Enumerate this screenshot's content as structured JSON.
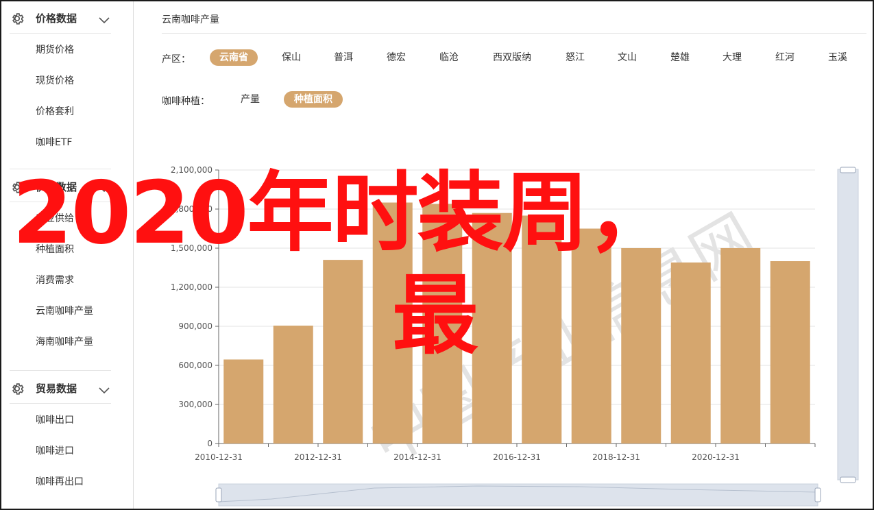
{
  "sidebar": {
    "groups": [
      {
        "title": "价格数据",
        "items": [
          "期货价格",
          "现货价格",
          "价格套利",
          "咖啡ETF"
        ]
      },
      {
        "title": "供需数据",
        "items": [
          "产业供给",
          "种植面积",
          "消费需求",
          "云南咖啡产量",
          "海南咖啡产量"
        ]
      },
      {
        "title": "贸易数据",
        "items": [
          "咖啡出口",
          "咖啡进口",
          "咖啡再出口"
        ]
      }
    ]
  },
  "main": {
    "title": "云南咖啡产量",
    "region_label": "产区：",
    "regions": [
      {
        "label": "云南省",
        "active": true
      },
      {
        "label": "保山",
        "active": false
      },
      {
        "label": "普洱",
        "active": false
      },
      {
        "label": "德宏",
        "active": false
      },
      {
        "label": "临沧",
        "active": false
      },
      {
        "label": "西双版纳",
        "active": false
      },
      {
        "label": "怒江",
        "active": false
      },
      {
        "label": "文山",
        "active": false
      },
      {
        "label": "楚雄",
        "active": false
      },
      {
        "label": "大理",
        "active": false
      },
      {
        "label": "红河",
        "active": false
      },
      {
        "label": "玉溪",
        "active": false
      }
    ],
    "type_label": "咖啡种植：",
    "types": [
      {
        "label": "产量",
        "active": false
      },
      {
        "label": "种植面积",
        "active": true
      }
    ]
  },
  "chart_data": {
    "type": "bar",
    "categories": [
      "2010-12-31",
      "2011-12-31",
      "2012-12-31",
      "2013-12-31",
      "2014-12-31",
      "2015-12-31",
      "2016-12-31",
      "2017-12-31",
      "2018-12-31",
      "2019-12-31",
      "2020-12-31",
      "2021-12-31"
    ],
    "x_tick_labels": [
      "2010-12-31",
      "2012-12-31",
      "2014-12-31",
      "2016-12-31",
      "2018-12-31",
      "2020-12-31"
    ],
    "values": [
      645000,
      905000,
      1410000,
      1850000,
      1840000,
      1770000,
      1750000,
      1650000,
      1500000,
      1390000,
      1500000,
      1400000
    ],
    "y_ticks": [
      "0",
      "300,000",
      "600,000",
      "900,000",
      "1,200,000",
      "1,500,000",
      "1,800,000",
      "2,100,000"
    ],
    "ylim": [
      0,
      2100000
    ],
    "bar_color": "#d5a66e",
    "grid": true
  },
  "watermark": {
    "text": "中国产业信息网"
  },
  "overlay": {
    "line1": "2020年时装周，",
    "line2": "最"
  },
  "colors": {
    "accent": "#d5a66e",
    "overlay_text": "#ff1010",
    "zoom_bg": "#dde3ec"
  },
  "icons": {
    "group_icon": "gear-icon",
    "collapse_icon": "chevron-down-icon"
  }
}
